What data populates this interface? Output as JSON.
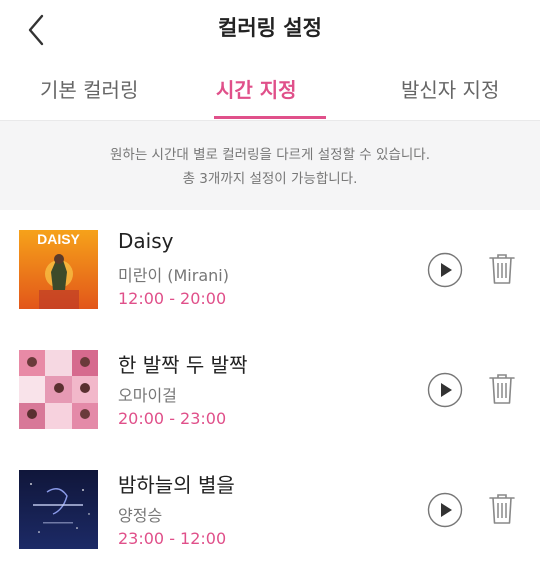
{
  "header": {
    "title": "컬러링 설정"
  },
  "tabs": [
    {
      "label": "기본 컬러링"
    },
    {
      "label": "시간 지정"
    },
    {
      "label": "발신자 지정"
    }
  ],
  "notice": {
    "line1": "원하는 시간대 별로 컬러링을 다르게 설정할 수 있습니다.",
    "line2": "총 3개까지 설정이 가능합니다."
  },
  "songs": [
    {
      "title": "Daisy",
      "artist": "미란이 (Mirani)",
      "time": "12:00 - 20:00",
      "art_text": "DAISY"
    },
    {
      "title": "한 발짝 두 발짝",
      "artist": "오마이걸",
      "time": "20:00 - 23:00"
    },
    {
      "title": "밤하늘의 별을",
      "artist": "양정승",
      "time": "23:00 - 12:00"
    }
  ],
  "colors": {
    "accent": "#e0508a",
    "notice_bg": "#f5f5f6"
  }
}
